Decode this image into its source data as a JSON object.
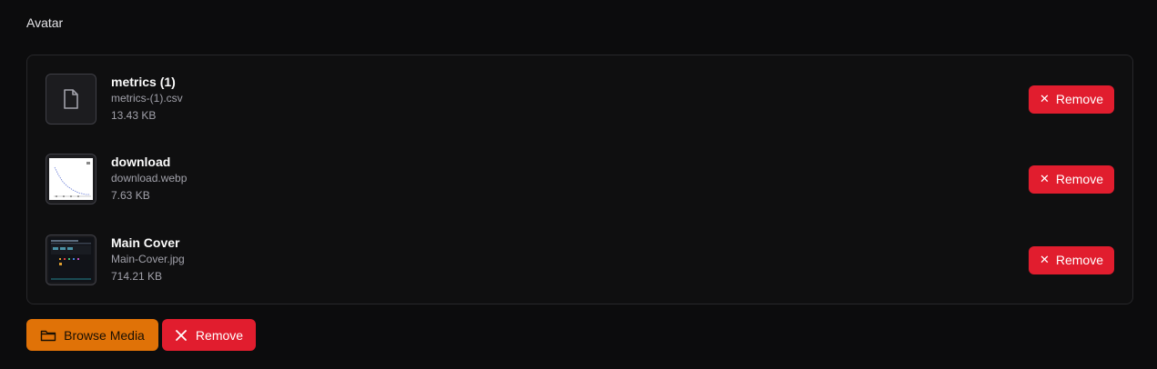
{
  "field": {
    "label": "Avatar"
  },
  "files": [
    {
      "title": "metrics (1)",
      "filename": "metrics-(1).csv",
      "size": "13.43 KB",
      "thumbnail": "file-icon",
      "remove_label": "Remove"
    },
    {
      "title": "download",
      "filename": "download.webp",
      "size": "7.63 KB",
      "thumbnail": "chart-preview-image",
      "remove_label": "Remove"
    },
    {
      "title": "Main Cover",
      "filename": "Main-Cover.jpg",
      "size": "714.21 KB",
      "thumbnail": "dashboard-preview-image",
      "remove_label": "Remove"
    }
  ],
  "actions": {
    "browse_label": "Browse Media",
    "browse_icon": "folder-icon",
    "remove_label": "Remove",
    "remove_icon": "close-icon"
  },
  "colors": {
    "danger": "#e11d2e",
    "warning": "#e07207",
    "background": "#0c0c0d",
    "border": "#27272a"
  }
}
